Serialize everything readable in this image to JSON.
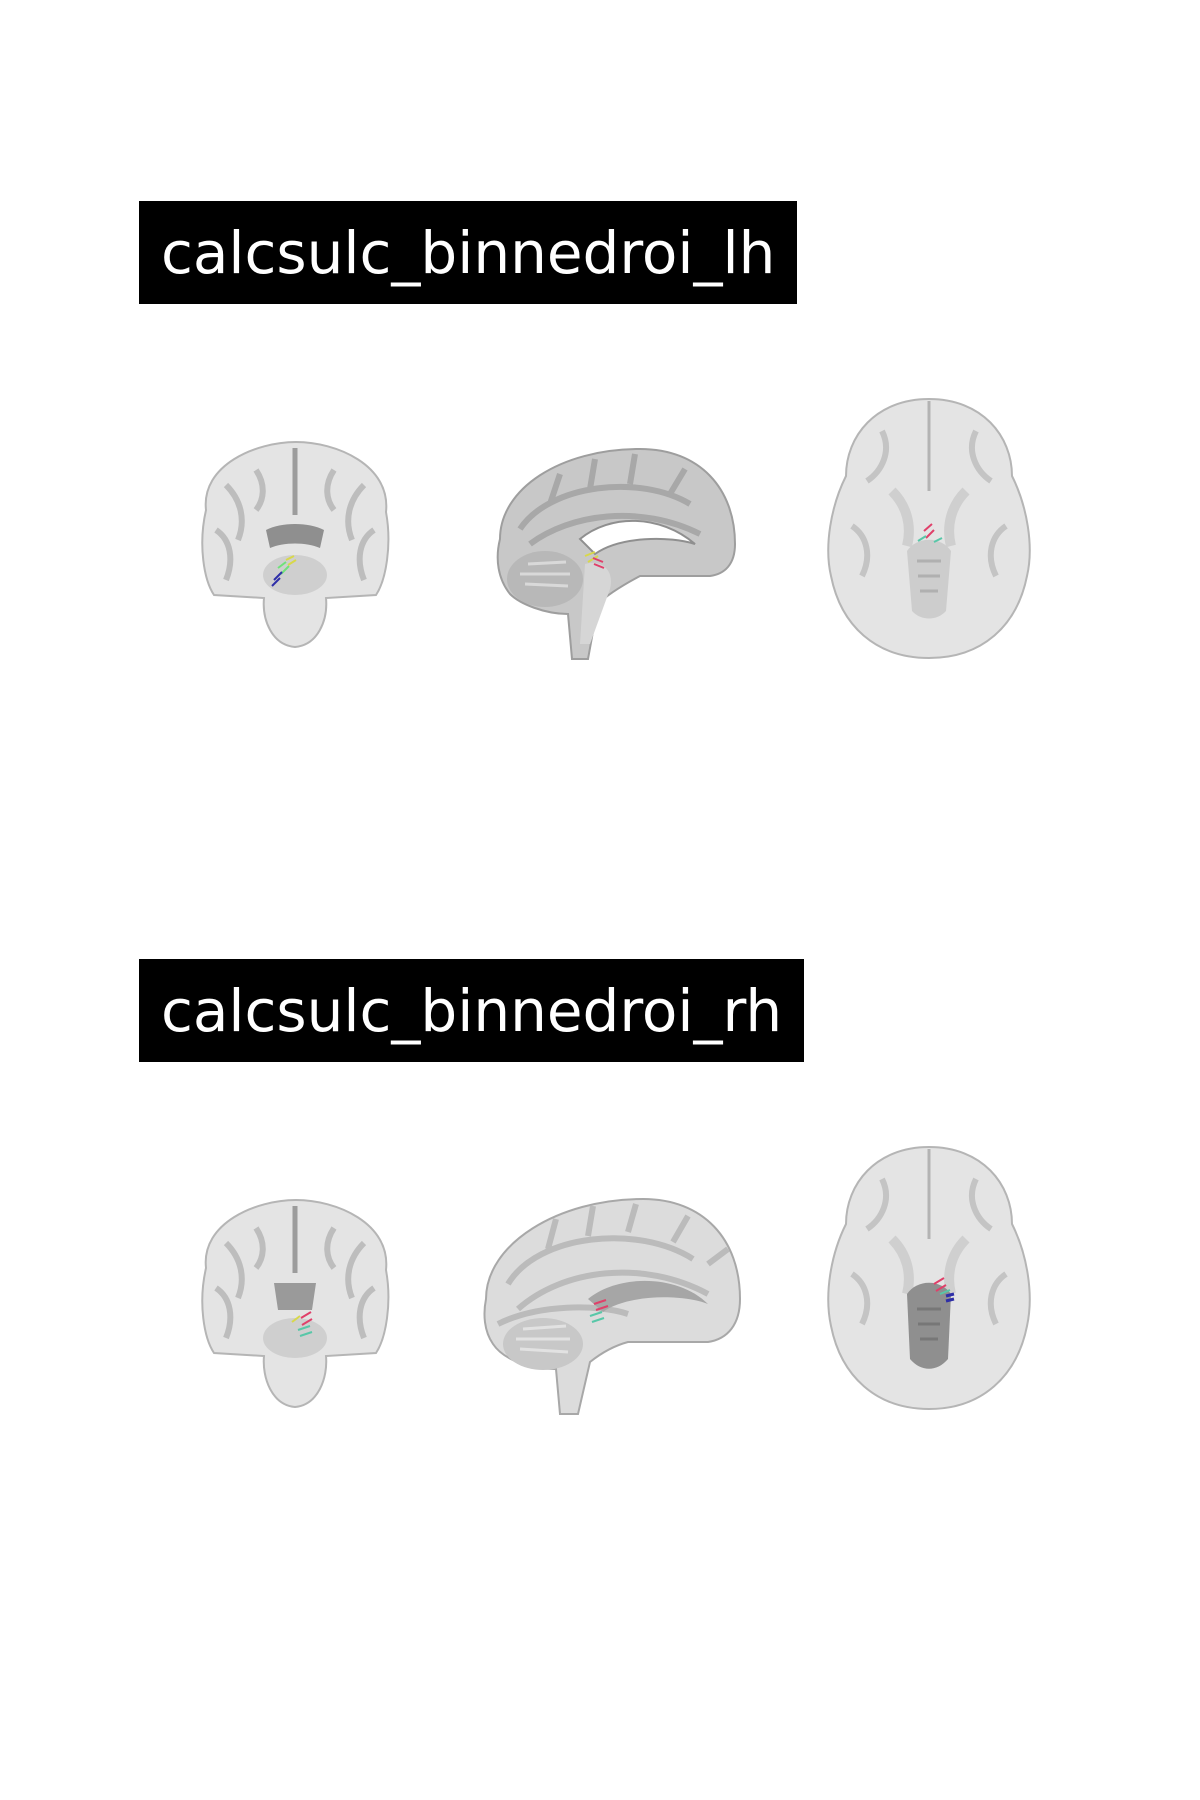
{
  "panels": [
    {
      "id": "lh",
      "title": "calcsulc_binnedroi_lh",
      "views": [
        {
          "name": "coronal-view"
        },
        {
          "name": "sagittal-view"
        },
        {
          "name": "axial-view"
        }
      ]
    },
    {
      "id": "rh",
      "title": "calcsulc_binnedroi_rh",
      "views": [
        {
          "name": "coronal-view"
        },
        {
          "name": "sagittal-view"
        },
        {
          "name": "axial-view"
        }
      ]
    }
  ],
  "colors": {
    "background": "#ffffff",
    "title_bg": "#000000",
    "title_text": "#ffffff",
    "brain_light": "#e4e4e4",
    "brain_mid": "#c8c8c8",
    "brain_dark": "#8f8f8f",
    "roi_colors": [
      "#2e2ea8",
      "#e0406a",
      "#58c7a8",
      "#d8d84a",
      "#6fe27a"
    ]
  }
}
